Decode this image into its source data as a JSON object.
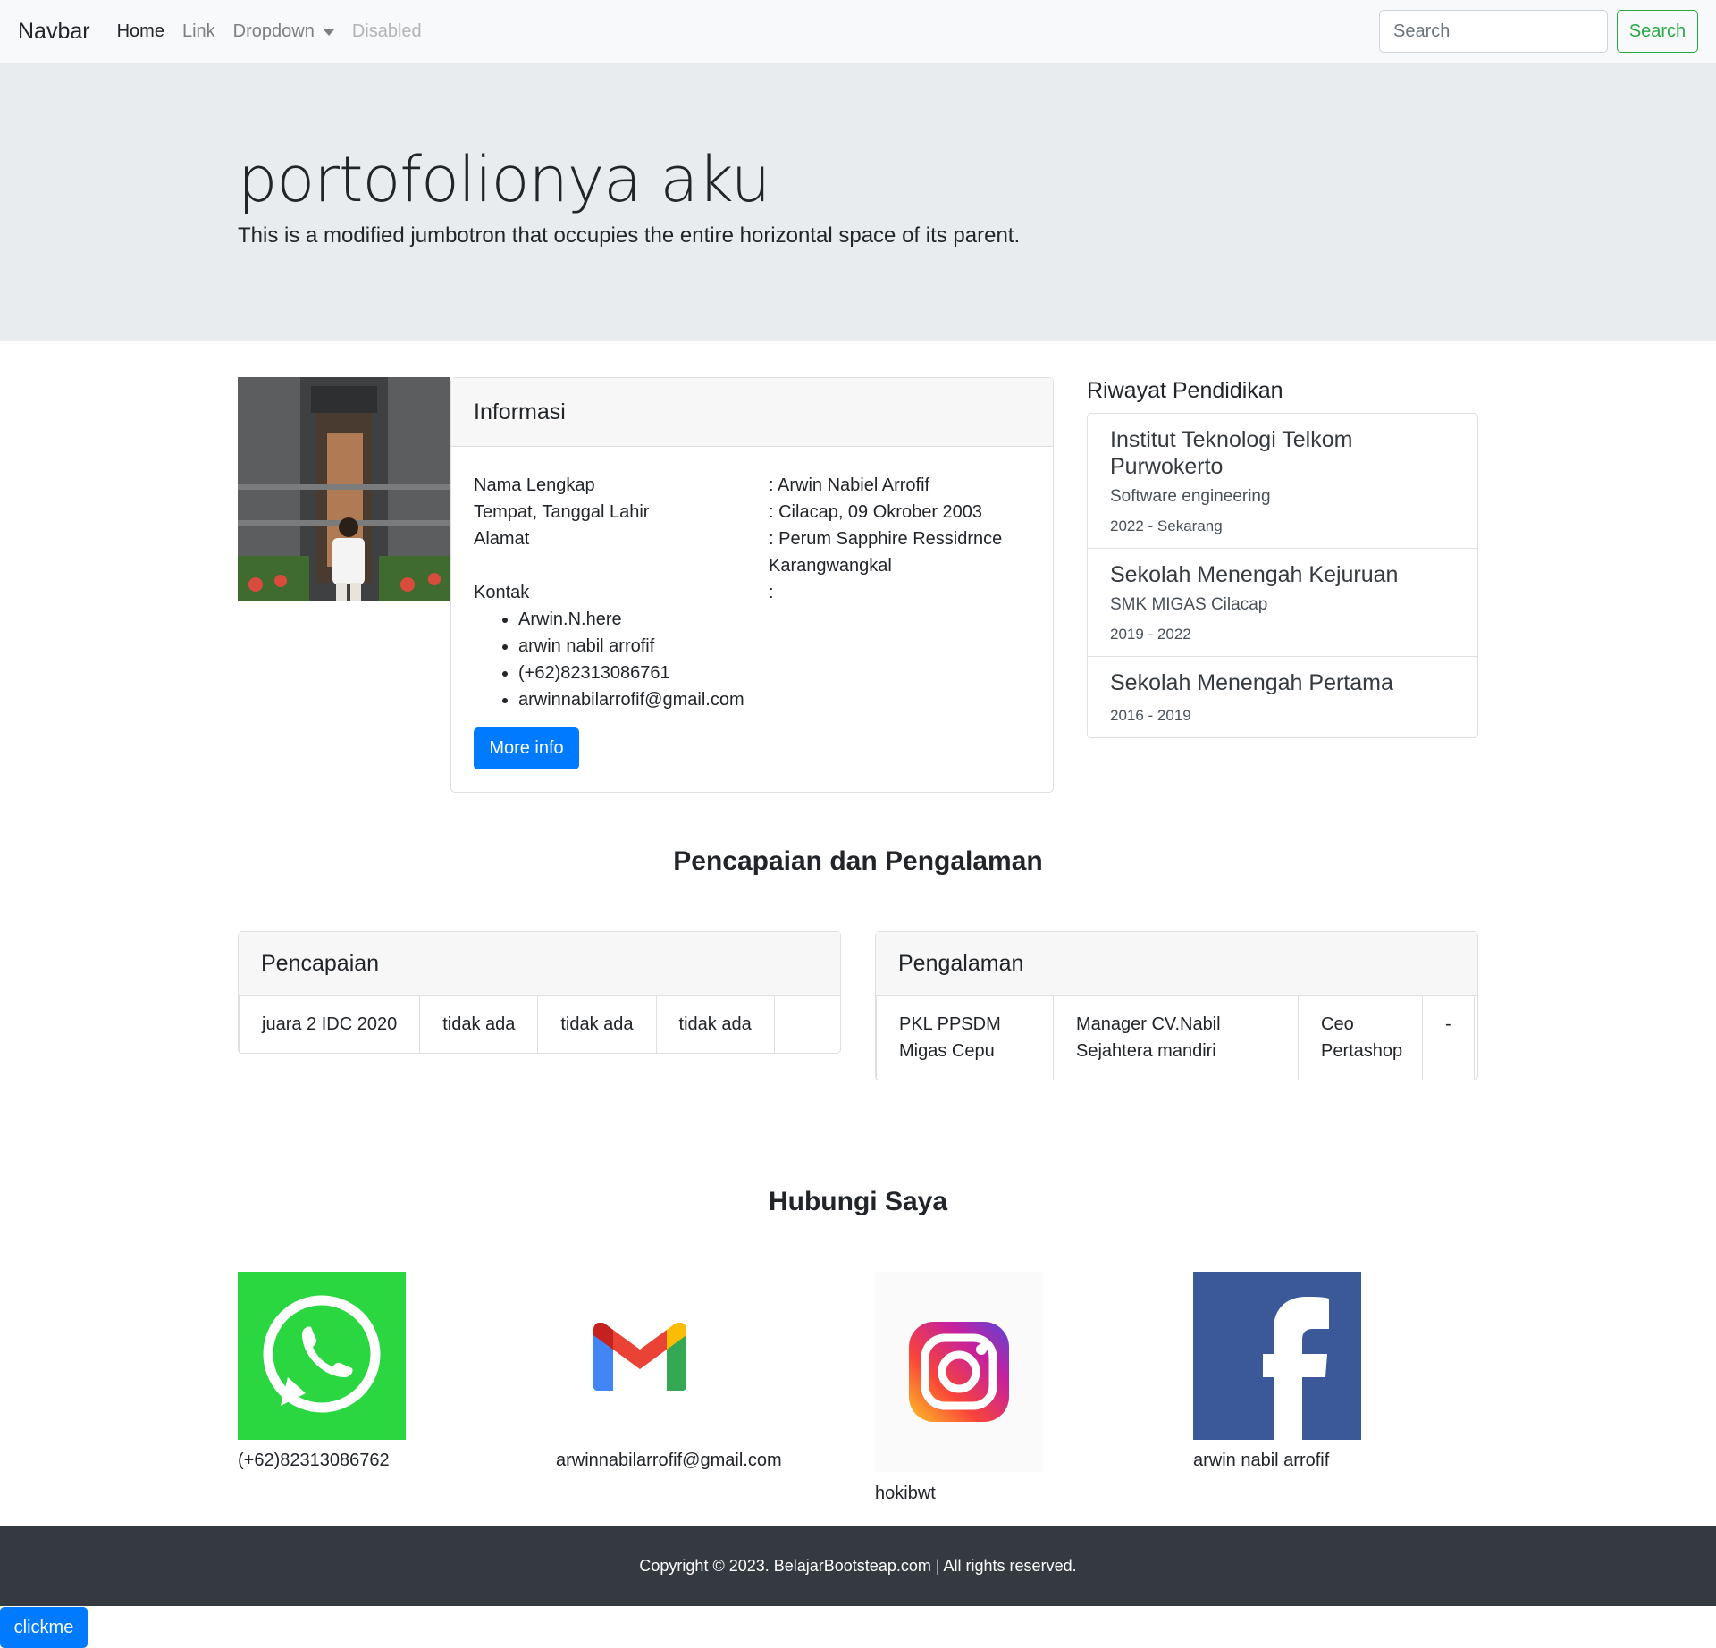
{
  "navbar": {
    "brand": "Navbar",
    "links": [
      "Home",
      "Link",
      "Dropdown",
      "Disabled"
    ],
    "search_placeholder": "Search",
    "search_button": "Search"
  },
  "jumbotron": {
    "title": "portofolionya aku",
    "lead": "This is a modified jumbotron that occupies the entire horizontal space of its parent."
  },
  "info": {
    "header": "Informasi",
    "rows": [
      {
        "label": "Nama Lengkap",
        "value": ": Arwin Nabiel Arrofif"
      },
      {
        "label": "Tempat, Tanggal Lahir",
        "value": ": Cilacap, 09 Okrober 2003"
      },
      {
        "label": "Alamat",
        "value": ": Perum Sapphire Ressidrnce Karangwangkal"
      },
      {
        "label": "Kontak",
        "value": ":"
      }
    ],
    "contacts": [
      "Arwin.N.here",
      "arwin nabil arrofif",
      "(+62)82313086761",
      "arwinnabilarrofif@gmail.com"
    ],
    "button": "More info"
  },
  "education": {
    "title": "Riwayat Pendidikan",
    "items": [
      {
        "name": "Institut Teknologi Telkom Purwokerto",
        "school": "Software engineering",
        "years": "2022 - Sekarang"
      },
      {
        "name": "Sekolah Menengah Kejuruan",
        "school": "SMK MIGAS Cilacap",
        "years": "2019 - 2022"
      },
      {
        "name": "Sekolah Menengah Pertama",
        "years": "2016 - 2019"
      }
    ]
  },
  "achievements_section": {
    "title": "Pencapaian dan Pengalaman"
  },
  "achievements": {
    "header": "Pencapaian",
    "cells": [
      "juara 2 IDC 2020",
      "tidak ada",
      "tidak ada",
      "tidak ada"
    ]
  },
  "experience": {
    "header": "Pengalaman",
    "cells": [
      "PKL PPSDM Migas Cepu",
      "Manager CV.Nabil Sejahtera mandiri",
      "Ceo Pertashop",
      "-"
    ]
  },
  "contact_section": {
    "title": "Hubungi Saya",
    "items": [
      {
        "icon": "whatsapp-icon",
        "label": "(+62)82313086762"
      },
      {
        "icon": "gmail-icon",
        "label": "arwinnabilarrofif@gmail.com"
      },
      {
        "icon": "instagram-icon",
        "label": "hokibwt"
      },
      {
        "icon": "facebook-icon",
        "label": "arwin nabil arrofif"
      }
    ]
  },
  "footer": {
    "text": "Copyright © 2023. BelajarBootsteap.com | All rights reserved."
  },
  "clickme": "clickme",
  "colors": {
    "primary": "#007bff",
    "success": "#28a745",
    "footer": "#343a40",
    "jumbotron": "#e9ecef"
  }
}
